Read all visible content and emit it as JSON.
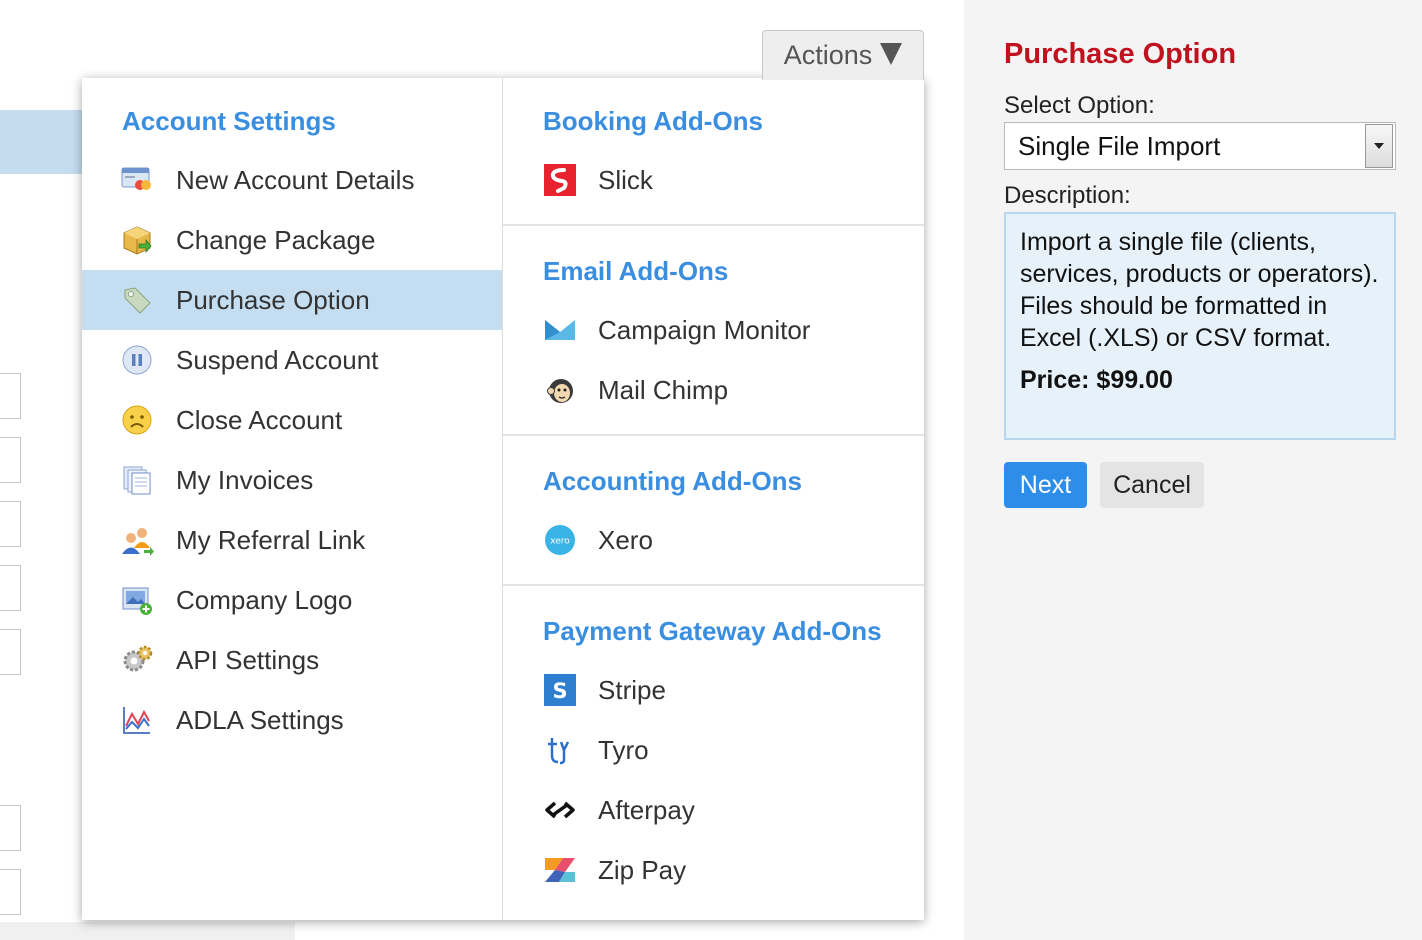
{
  "actions": {
    "label": "Actions"
  },
  "menu": {
    "left": {
      "heading": "Account Settings",
      "items": [
        {
          "label": "New Account Details",
          "icon": "account-card-icon"
        },
        {
          "label": "Change Package",
          "icon": "package-icon"
        },
        {
          "label": "Purchase Option",
          "icon": "tag-icon",
          "active": true
        },
        {
          "label": "Suspend Account",
          "icon": "pause-icon"
        },
        {
          "label": "Close Account",
          "icon": "sad-face-icon"
        },
        {
          "label": "My Invoices",
          "icon": "invoices-icon"
        },
        {
          "label": "My Referral Link",
          "icon": "referral-users-icon"
        },
        {
          "label": "Company Logo",
          "icon": "image-add-icon"
        },
        {
          "label": "API Settings",
          "icon": "gears-icon"
        },
        {
          "label": "ADLA Settings",
          "icon": "chart-icon"
        }
      ]
    },
    "right": {
      "sections": [
        {
          "heading": "Booking Add-Ons",
          "items": [
            {
              "label": "Slick",
              "icon": "slick-icon"
            }
          ]
        },
        {
          "heading": "Email Add-Ons",
          "items": [
            {
              "label": "Campaign Monitor",
              "icon": "campaign-monitor-icon"
            },
            {
              "label": "Mail Chimp",
              "icon": "mailchimp-icon"
            }
          ]
        },
        {
          "heading": "Accounting Add-Ons",
          "items": [
            {
              "label": "Xero",
              "icon": "xero-icon"
            }
          ]
        },
        {
          "heading": "Payment Gateway Add-Ons",
          "items": [
            {
              "label": "Stripe",
              "icon": "stripe-icon"
            },
            {
              "label": "Tyro",
              "icon": "tyro-icon"
            },
            {
              "label": "Afterpay",
              "icon": "afterpay-icon"
            },
            {
              "label": "Zip Pay",
              "icon": "zip-pay-icon"
            }
          ]
        }
      ]
    }
  },
  "panel": {
    "title": "Purchase Option",
    "select_label": "Select Option:",
    "selected_option": "Single File Import",
    "description_label": "Description:",
    "description": "Import a single file (clients, services, products or operators). Files should be formatted in Excel (.XLS) or CSV format.",
    "price": "Price: $99.00",
    "next_label": "Next",
    "cancel_label": "Cancel"
  },
  "colors": {
    "accent_blue": "#3a8ee0",
    "title_red": "#c0121e",
    "active_row": "#c4ddf0",
    "next_button": "#2e8de8"
  }
}
